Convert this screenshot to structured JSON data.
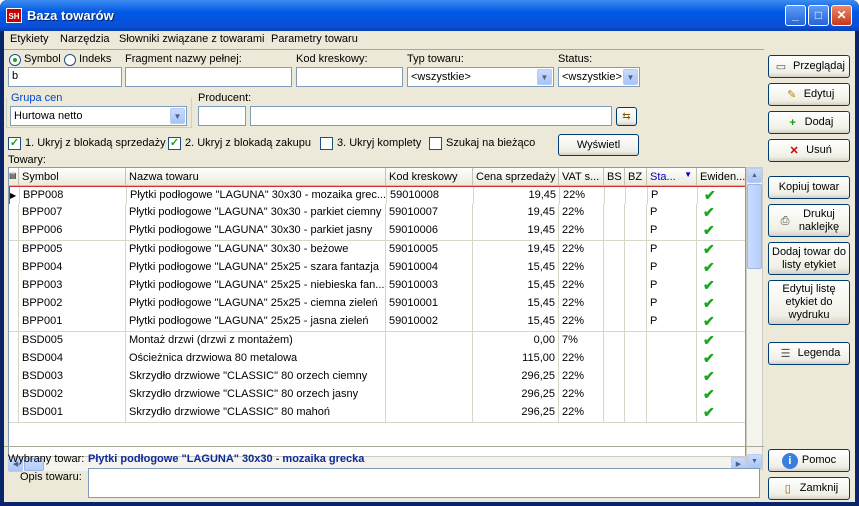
{
  "window": {
    "title": "Baza towarów",
    "icon": "SH"
  },
  "menu": [
    "Etykiety",
    "Narzędzia",
    "Słowniki związane z towarami",
    "Parametry towaru"
  ],
  "search": {
    "radio_symbol": "Symbol",
    "radio_index": "Indeks",
    "symbol_value": "b",
    "fragment_label": "Fragment nazwy pełnej:",
    "fragment_value": "",
    "barcode_label": "Kod kreskowy:",
    "barcode_value": "",
    "type_label": "Typ towaru:",
    "type_value": "<wszystkie>",
    "status_label": "Status:",
    "status_value": "<wszystkie>",
    "price_group_label": "Grupa cen",
    "price_group_value": "Hurtowa netto",
    "producer_label": "Producent:",
    "producer_code": "",
    "producer_name": ""
  },
  "filters": {
    "hide_sale_blocked": "1. Ukryj z blokadą sprzedaży",
    "hide_purchase_blocked": "2. Ukryj z blokadą zakupu",
    "hide_sets": "3. Ukryj komplety",
    "search_live": "Szukaj na bieżąco",
    "show_button": "Wyświetl"
  },
  "grid": {
    "caption": "Towary:",
    "columns": [
      "Symbol",
      "Nazwa towaru",
      "Kod kreskowy",
      "Cena sprzedaży",
      "VAT s...",
      "BS",
      "BZ",
      "Sta...",
      "Ewiden..."
    ],
    "rows": [
      {
        "symbol": "BPP008",
        "name": "Płytki podłogowe \"LAGUNA\" 30x30 - mozaika grec...",
        "barcode": "59010008",
        "price": "19,45",
        "vat": "22%",
        "bs": "",
        "bz": "",
        "status": "P",
        "tracked": "✔"
      },
      {
        "symbol": "BPP007",
        "name": "Płytki podłogowe \"LAGUNA\" 30x30 - parkiet ciemny",
        "barcode": "59010007",
        "price": "19,45",
        "vat": "22%",
        "bs": "",
        "bz": "",
        "status": "P",
        "tracked": "✔"
      },
      {
        "symbol": "BPP006",
        "name": "Płytki podłogowe \"LAGUNA\" 30x30 - parkiet jasny",
        "barcode": "59010006",
        "price": "19,45",
        "vat": "22%",
        "bs": "",
        "bz": "",
        "status": "P",
        "tracked": "✔"
      },
      {
        "symbol": "BPP005",
        "name": "Płytki podłogowe \"LAGUNA\" 30x30 - beżowe",
        "barcode": "59010005",
        "price": "19,45",
        "vat": "22%",
        "bs": "",
        "bz": "",
        "status": "P",
        "tracked": "✔"
      },
      {
        "symbol": "BPP004",
        "name": "Płytki podłogowe \"LAGUNA\" 25x25 - szara fantazja",
        "barcode": "59010004",
        "price": "15,45",
        "vat": "22%",
        "bs": "",
        "bz": "",
        "status": "P",
        "tracked": "✔"
      },
      {
        "symbol": "BPP003",
        "name": "Płytki podłogowe \"LAGUNA\" 25x25 - niebieska fan...",
        "barcode": "59010003",
        "price": "15,45",
        "vat": "22%",
        "bs": "",
        "bz": "",
        "status": "P",
        "tracked": "✔"
      },
      {
        "symbol": "BPP002",
        "name": "Płytki podłogowe \"LAGUNA\" 25x25 - ciemna zieleń",
        "barcode": "59010001",
        "price": "15,45",
        "vat": "22%",
        "bs": "",
        "bz": "",
        "status": "P",
        "tracked": "✔"
      },
      {
        "symbol": "BPP001",
        "name": "Płytki podłogowe \"LAGUNA\" 25x25 - jasna zieleń",
        "barcode": "59010002",
        "price": "15,45",
        "vat": "22%",
        "bs": "",
        "bz": "",
        "status": "P",
        "tracked": "✔"
      },
      {
        "symbol": "BSD005",
        "name": "Montaż drzwi (drzwi z montażem)",
        "barcode": "",
        "price": "0,00",
        "vat": "7%",
        "bs": "",
        "bz": "",
        "status": "",
        "tracked": "✔"
      },
      {
        "symbol": "BSD004",
        "name": "Ościeżnica drzwiowa 80 metalowa",
        "barcode": "",
        "price": "115,00",
        "vat": "22%",
        "bs": "",
        "bz": "",
        "status": "",
        "tracked": "✔"
      },
      {
        "symbol": "BSD003",
        "name": "Skrzydło drzwiowe \"CLASSIC\" 80 orzech ciemny",
        "barcode": "",
        "price": "296,25",
        "vat": "22%",
        "bs": "",
        "bz": "",
        "status": "",
        "tracked": "✔"
      },
      {
        "symbol": "BSD002",
        "name": "Skrzydło drzwiowe \"CLASSIC\" 80 orzech jasny",
        "barcode": "",
        "price": "296,25",
        "vat": "22%",
        "bs": "",
        "bz": "",
        "status": "",
        "tracked": "✔"
      },
      {
        "symbol": "BSD001",
        "name": "Skrzydło drzwiowe \"CLASSIC\" 80 mahoń",
        "barcode": "",
        "price": "296,25",
        "vat": "22%",
        "bs": "",
        "bz": "",
        "status": "",
        "tracked": "✔"
      }
    ]
  },
  "bottom": {
    "selected_label": "Wybrany towar:",
    "selected_value": "Płytki podłogowe \"LAGUNA\" 30x30 - mozaika grecka",
    "description_label": "Opis towaru:",
    "description_value": ""
  },
  "side_buttons": {
    "browse": "Przeglądaj",
    "edit": "Edytuj",
    "add": "Dodaj",
    "delete": "Usuń",
    "copy": "Kopiuj towar",
    "print_label": "Drukuj naklejkę",
    "add_to_labels": "Dodaj towar do listy etykiet",
    "edit_label_list": "Edytuj listę etykiet do wydruku",
    "legend": "Legenda",
    "help": "Pomoc",
    "close": "Zamknij"
  },
  "colors": {
    "title_blue": "#0058e6",
    "face": "#ece9d8",
    "tick_green": "#19a81f",
    "selected_text": "#0b2aa0"
  }
}
